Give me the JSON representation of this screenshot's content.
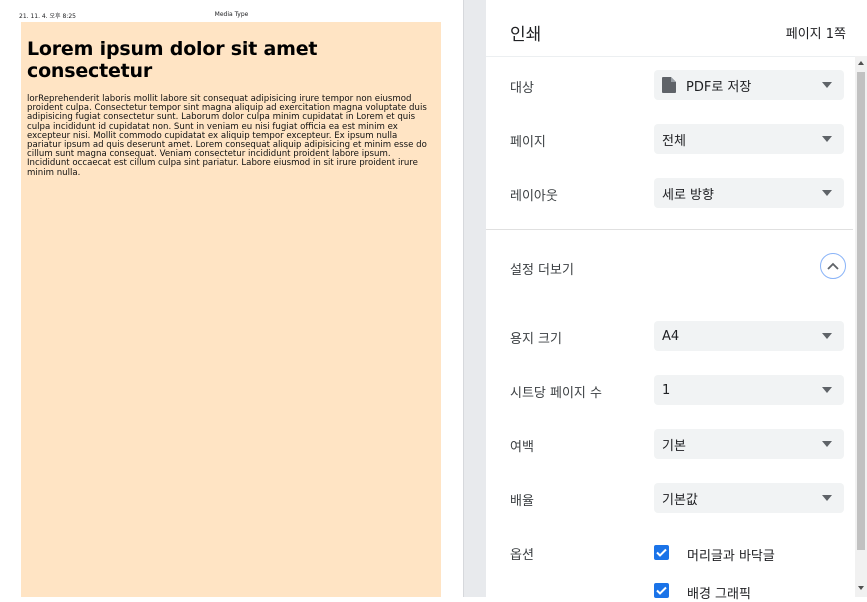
{
  "preview": {
    "header_date": "21. 11. 4. 오후 8:25",
    "header_title": "Media Type",
    "heading": "Lorem ipsum dolor sit amet consectetur",
    "paragraph": "lorReprehenderit laboris mollit labore sit consequat adipisicing irure tempor non eiusmod proident culpa. Consectetur tempor sint magna aliquip ad exercitation magna voluptate duis adipisicing fugiat consectetur sunt. Laborum dolor culpa minim cupidatat in Lorem et quis culpa incididunt id cupidatat non. Sunt in veniam eu nisi fugiat officia ea est minim ex excepteur nisi. Mollit commodo cupidatat ex aliquip tempor excepteur. Ex ipsum nulla pariatur ipsum ad quis deserunt amet. Lorem consequat aliquip adipisicing et minim esse do cillum sunt magna consequat. Veniam consectetur incididunt proident labore ipsum. Incididunt occaecat est cillum culpa sint pariatur. Labore eiusmod in sit irure proident irure minim nulla.",
    "page_background": "#ffe4c4"
  },
  "settings": {
    "title": "인쇄",
    "page_count": "페이지 1쪽",
    "destination": {
      "label": "대상",
      "value": "PDF로 저장",
      "icon": "pdf-file-icon"
    },
    "pages": {
      "label": "페이지",
      "value": "전체"
    },
    "layout": {
      "label": "레이아웃",
      "value": "세로 방향"
    },
    "more_settings": {
      "label": "설정 더보기",
      "icon": "chevron-up-icon"
    },
    "paper_size": {
      "label": "용지 크기",
      "value": "A4"
    },
    "pages_per_sheet": {
      "label": "시트당 페이지 수",
      "value": "1"
    },
    "margins": {
      "label": "여백",
      "value": "기본"
    },
    "scale": {
      "label": "배율",
      "value": "기본값"
    },
    "options": {
      "label": "옵션",
      "headers_footers": {
        "label": "머리글과 바닥글",
        "checked": true
      },
      "background_graphics": {
        "label": "배경 그래픽",
        "checked": true
      }
    }
  },
  "colors": {
    "accent": "#1a73e8",
    "select_bg": "#f1f3f4"
  }
}
